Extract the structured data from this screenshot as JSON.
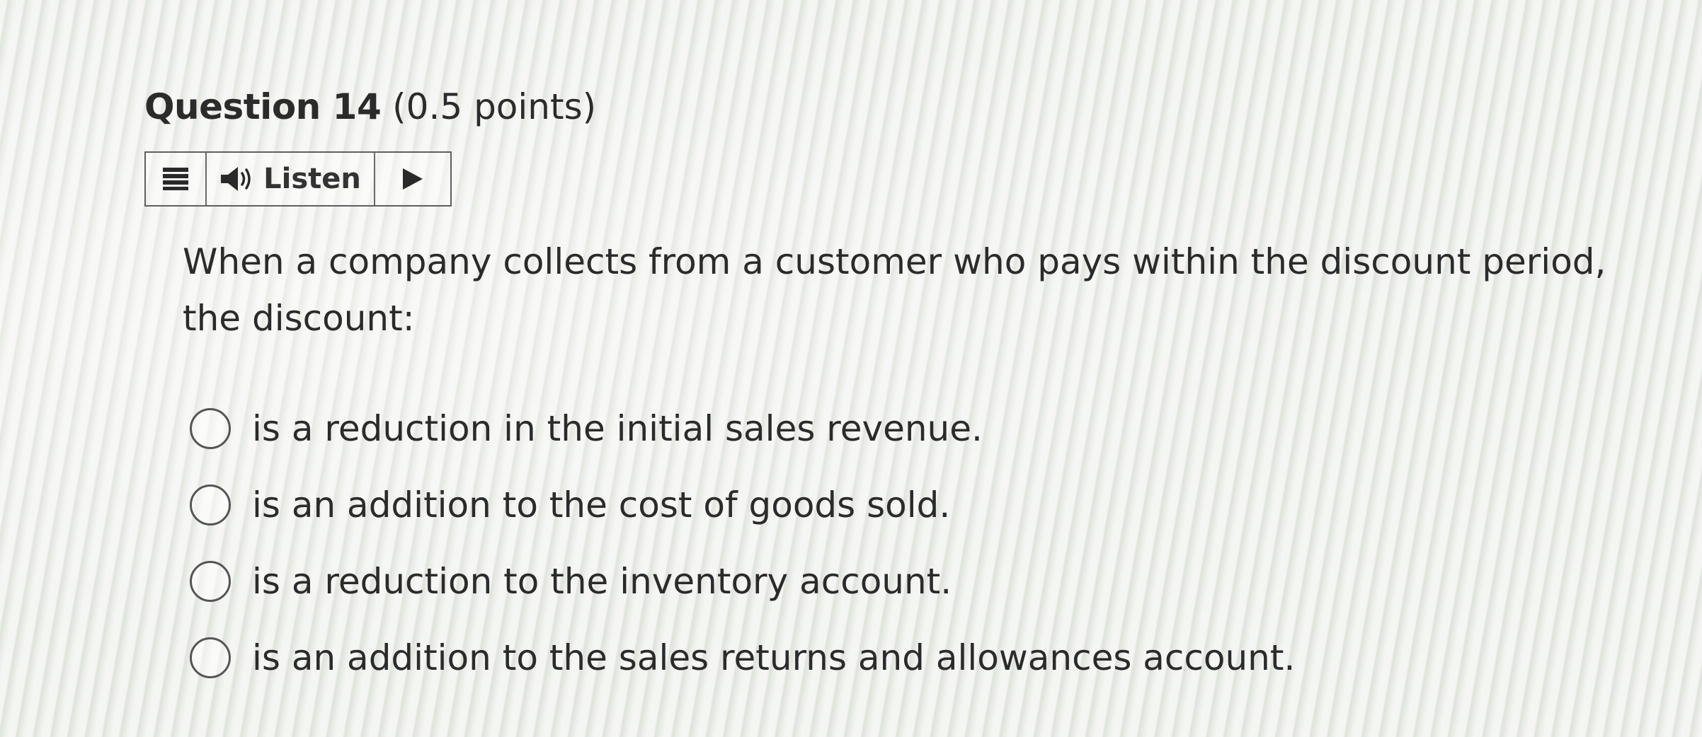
{
  "question": {
    "title": "Question 14",
    "points": "(0.5 points)",
    "text": "When a company collects from a customer who pays within the discount period, the discount:"
  },
  "toolbar": {
    "menu_icon": "menu-icon",
    "speaker_icon": "speaker-icon",
    "listen_label": "Listen",
    "play_icon": "play-icon"
  },
  "options": [
    {
      "label": "is a reduction in the initial sales revenue.",
      "selected": false
    },
    {
      "label": "is an addition to the cost of goods sold.",
      "selected": false
    },
    {
      "label": "is a reduction to the inventory account.",
      "selected": false
    },
    {
      "label": "is an addition to the sales returns and allowances account.",
      "selected": false
    }
  ]
}
